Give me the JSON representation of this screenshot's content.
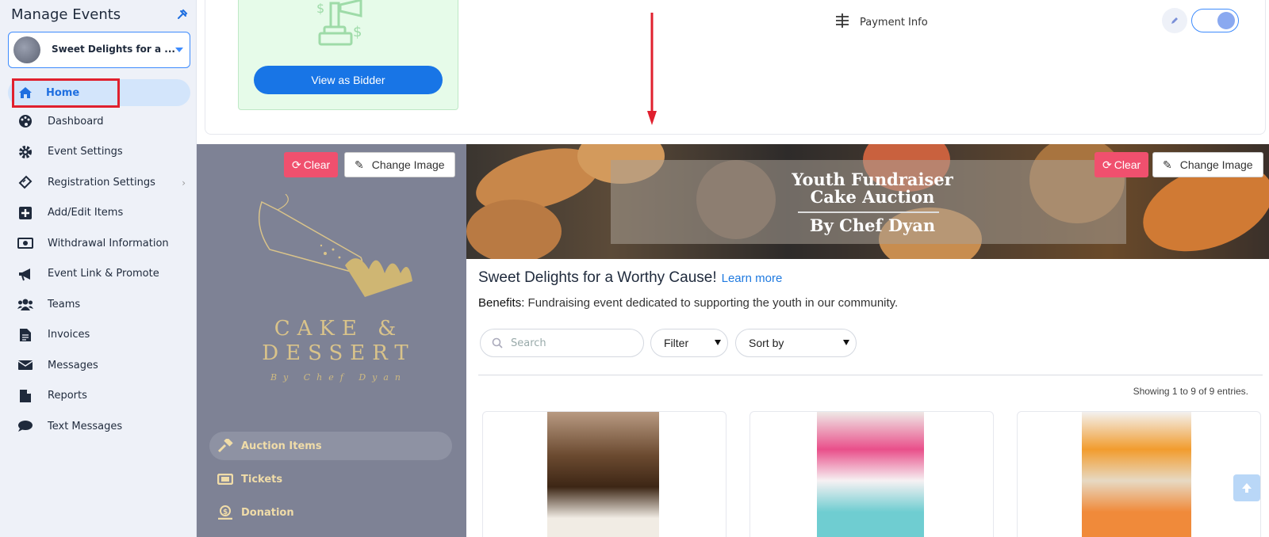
{
  "sidebar": {
    "title": "Manage Events",
    "event_name": "Sweet Delights for a ...",
    "items": [
      {
        "label": "Home",
        "icon": "home-icon"
      },
      {
        "label": "Dashboard",
        "icon": "palette-icon"
      },
      {
        "label": "Event Settings",
        "icon": "gear-icon"
      },
      {
        "label": "Registration Settings",
        "icon": "ticket-icon"
      },
      {
        "label": "Add/Edit Items",
        "icon": "plus-square-icon"
      },
      {
        "label": "Withdrawal Information",
        "icon": "money-icon"
      },
      {
        "label": "Event Link & Promote",
        "icon": "megaphone-icon"
      },
      {
        "label": "Teams",
        "icon": "users-icon"
      },
      {
        "label": "Invoices",
        "icon": "invoice-icon"
      },
      {
        "label": "Messages",
        "icon": "envelope-icon"
      },
      {
        "label": "Reports",
        "icon": "file-icon"
      },
      {
        "label": "Text Messages",
        "icon": "chat-icon"
      }
    ],
    "chevron": "›"
  },
  "top": {
    "view_bidder": "View as Bidder",
    "payment_info": "Payment Info"
  },
  "preview_left": {
    "clear": "Clear",
    "change_image": "Change Image",
    "logo_line1": "CAKE &",
    "logo_line2": "DESSERT",
    "logo_sig": "By Chef Dyan",
    "nav": [
      {
        "label": "Auction Items",
        "icon": "gavel-icon"
      },
      {
        "label": "Tickets",
        "icon": "ticket-icon"
      },
      {
        "label": "Donation",
        "icon": "donation-icon"
      }
    ]
  },
  "banner": {
    "clear": "Clear",
    "change_image": "Change Image",
    "line1": "Youth Fundraiser",
    "line2": "Cake Auction",
    "line3": "By Chef Dyan"
  },
  "event": {
    "title": "Sweet Delights for a Worthy Cause!",
    "learn_more": "Learn more",
    "benefits_label": "Benefits:",
    "benefits_text": "Fundraising event dedicated to supporting the youth in our community."
  },
  "filters": {
    "search_placeholder": "Search",
    "filter_label": "Filter",
    "sort_label": "Sort by"
  },
  "showing": "Showing 1 to 9 of 9 entries.",
  "colors": {
    "accent": "#1875e6",
    "clear_red": "#f0506e",
    "sidebar_bg": "#eef1f8",
    "preview_bg": "#7e8295",
    "logo_gold": "#d9c38a"
  }
}
